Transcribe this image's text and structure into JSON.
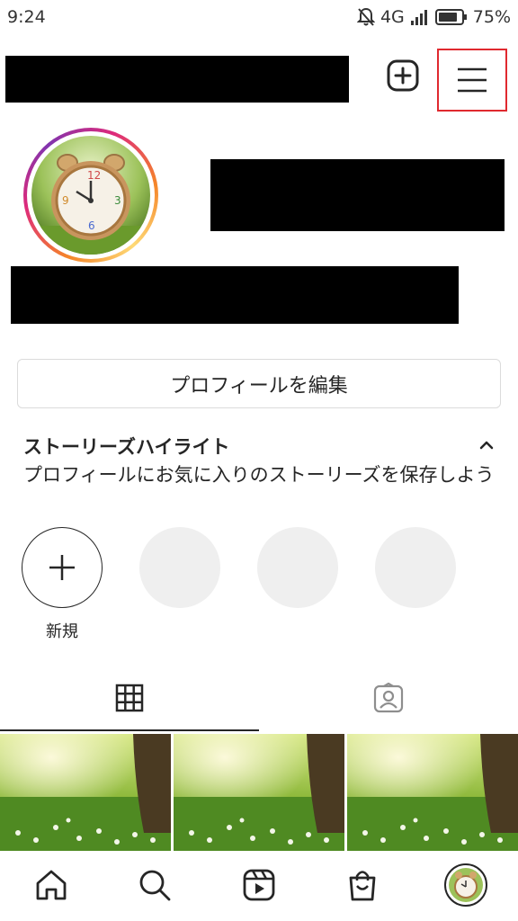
{
  "status_bar": {
    "time": "9:24",
    "network": "4G",
    "battery": "75%",
    "icons": [
      "notifications-off-icon",
      "signal-icon",
      "battery-icon"
    ]
  },
  "header": {
    "icons": [
      "add-post-icon",
      "hamburger-menu-icon"
    ],
    "menu_highlight_color": "#e0292f"
  },
  "profile": {
    "edit_profile_label": "プロフィールを編集"
  },
  "highlights": {
    "title": "ストーリーズハイライト",
    "description": "プロフィールにお気に入りのストーリーズを保存しよう",
    "new_label": "新規"
  },
  "tabs": [
    {
      "icon": "grid-icon",
      "active": true
    },
    {
      "icon": "tagged-icon",
      "active": false
    }
  ],
  "bottom_nav": [
    {
      "icon": "home-icon"
    },
    {
      "icon": "search-icon"
    },
    {
      "icon": "reels-icon"
    },
    {
      "icon": "shop-icon"
    },
    {
      "icon": "profile-avatar-icon"
    }
  ],
  "colors": {
    "text": "#262626",
    "border": "#dbdbdb",
    "placeholder": "#efefef"
  }
}
